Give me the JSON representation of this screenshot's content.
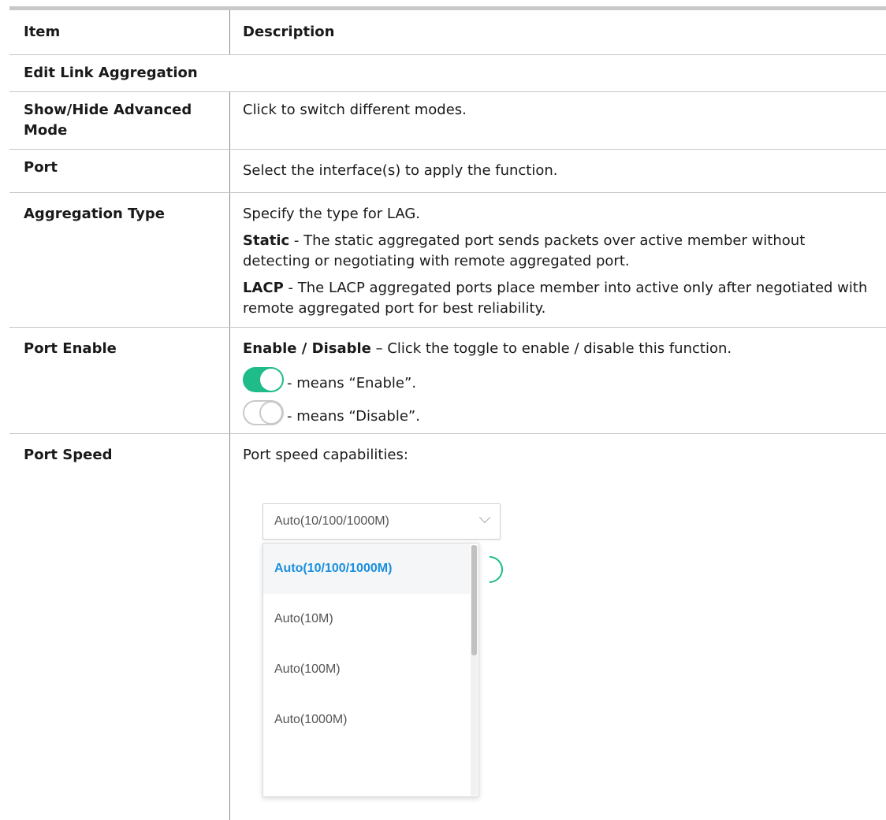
{
  "header": {
    "item": "Item",
    "description": "Description"
  },
  "section_title": "Edit Link Aggregation",
  "rows": [
    {
      "item": "Show/Hide Advanced Mode",
      "description": "Click to switch different modes."
    },
    {
      "item": "Port",
      "description": "Select the interface(s) to apply the function."
    },
    {
      "item": "Aggregation Type",
      "intro": "Specify the type for LAG.",
      "static_label": "Static",
      "static_text": " - The static aggregated port sends packets over active member without detecting or negotiating with remote aggregated port.",
      "lacp_label": "LACP",
      "lacp_text": " - The LACP aggregated ports place member into active only after negotiated with remote aggregated port for best reliability."
    },
    {
      "item": "Port Enable",
      "enable_label": "Enable / Disable",
      "enable_text": " – Click the toggle to enable / disable this function.",
      "on_text": "- means “Enable”.",
      "off_text": "- means “Disable”."
    },
    {
      "item": "Port Speed",
      "intro": "Port speed capabilities:"
    }
  ],
  "speed_select": {
    "value": "Auto(10/100/1000M)",
    "options": [
      "Auto(10/100/1000M)",
      "Auto(10M)",
      "Auto(100M)",
      "Auto(1000M)"
    ],
    "selected_color": "#1a8fe0"
  },
  "colors": {
    "toggle_on": "#1fbb88",
    "toggle_off_border": "#c9c9c9"
  }
}
